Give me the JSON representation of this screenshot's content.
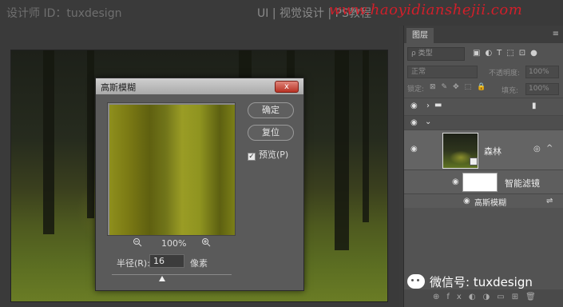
{
  "watermarks": {
    "designer_id": "设计师 ID：tuxdesign",
    "category": "UI | 视觉设计 | PS教程",
    "site": "www.haoyidianshejii.com",
    "wechat": "微信号: tuxdesign"
  },
  "dialog": {
    "title": "高斯模糊",
    "close_label": "x",
    "ok_label": "确定",
    "reset_label": "复位",
    "preview_label": "预览(P)",
    "preview_checked": true,
    "zoom_value": "100%",
    "zoom_out_icon": "zoom-out-icon",
    "zoom_in_icon": "zoom-in-icon",
    "radius_label": "半径(R):",
    "radius_value": "16",
    "radius_unit": "像素"
  },
  "layers_panel": {
    "tab_label": "图层",
    "filter_placeholder": "ρ 类型",
    "blend_mode": "正常",
    "opacity_label": "不透明度:",
    "opacity_value": "100%",
    "lock_label": "锁定:",
    "fill_label": "填充:",
    "fill_value": "100%",
    "layers": [
      {
        "name": "森林"
      },
      {
        "name": "智能滤镜"
      },
      {
        "name": "高斯模糊"
      }
    ]
  },
  "colors": {
    "accent_red": "#d11f2a",
    "panel_bg": "#535353",
    "selected_layer": "#646464"
  }
}
